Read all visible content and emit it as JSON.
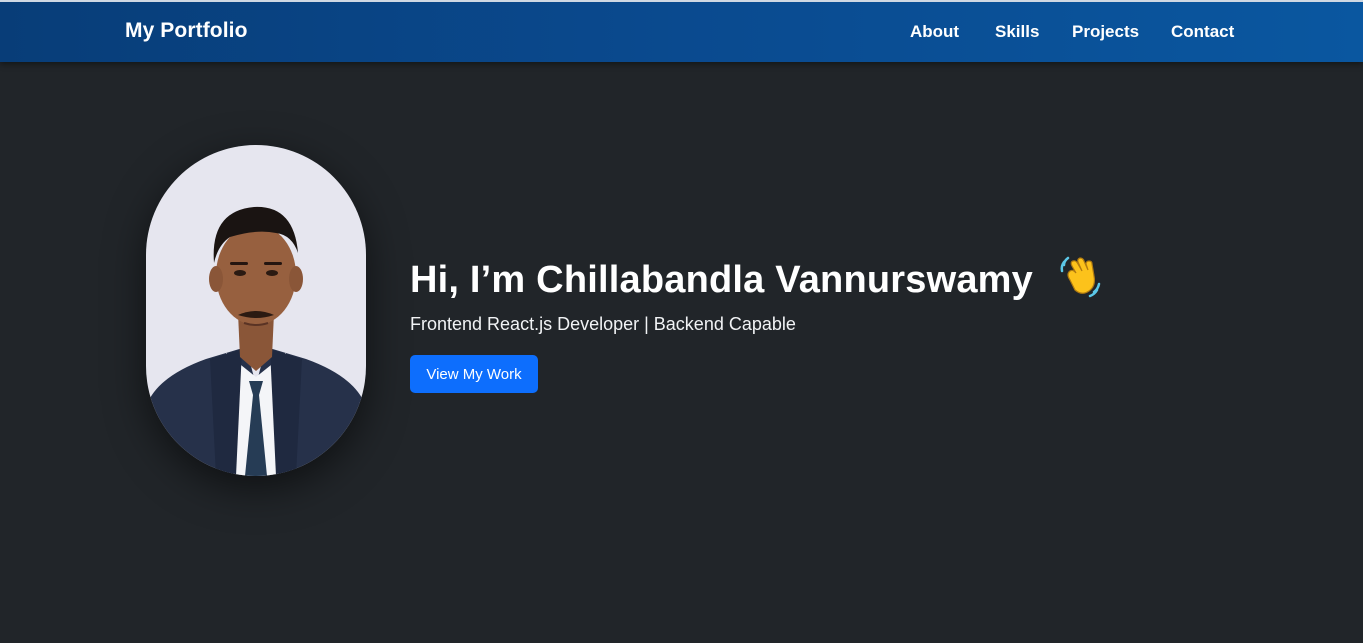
{
  "navbar": {
    "brand": "My Portfolio",
    "links": [
      {
        "label": "About"
      },
      {
        "label": "Skills"
      },
      {
        "label": "Projects"
      },
      {
        "label": "Contact"
      }
    ],
    "gradient_start": "#083d78",
    "gradient_end": "#0a57a0"
  },
  "hero": {
    "title": "Hi, I’m Chillabandla Vannurswamy",
    "title_emoji": "waving-hand-icon",
    "subtitle": "Frontend React.js Developer | Backend Capable",
    "cta_label": "View My Work",
    "cta_color": "#0d6efd",
    "background": "#212529"
  }
}
